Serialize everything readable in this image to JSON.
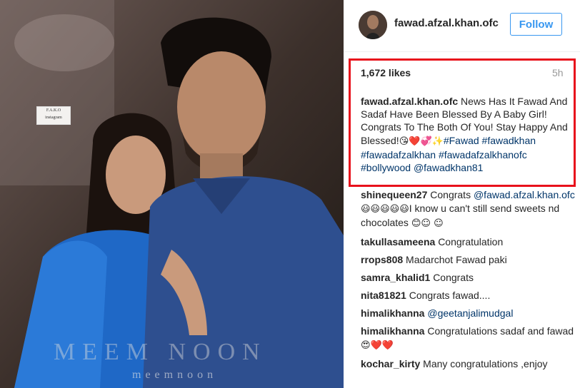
{
  "header": {
    "username": "fawad.afzal.khan.ofc",
    "follow_label": "Follow"
  },
  "post": {
    "likes": "1,672 likes",
    "time": "5h",
    "caption_user": "fawad.afzal.khan.ofc",
    "caption_text": "News Has It Fawad And Sadaf Have Been Blessed By A Baby Girl! Congrats To The Both Of You! Stay Happy And Blessed!",
    "caption_emoji": "😘❤️💞✨",
    "hashtags": [
      "#Fawad",
      "#fawadkhan",
      "#fawadafzalkhan",
      "#fawadafzalkhanofc",
      "#bollywood"
    ],
    "mention": "@fawadkhan81"
  },
  "photo": {
    "logo_text_1": "F.A.K.O",
    "logo_text_2": "instagram",
    "watermark_main": "MEEM NOON",
    "watermark_sub": "meemnoon"
  },
  "comments": [
    {
      "user": "shinequeen27",
      "text": "Congrats",
      "mention": "@fawad.afzal.khan.ofc",
      "emoji": "😃😃😃😃😃",
      "text2": "I know u can't still send sweets nd chocolates",
      "emoji2": "😊☺ ☺"
    },
    {
      "user": "takullasameena",
      "text": "Congratulation"
    },
    {
      "user": "rrops808",
      "text": "Madarchot Fawad paki"
    },
    {
      "user": "samra_khalid1",
      "text": "Congrats"
    },
    {
      "user": "nita81821",
      "text": "Congrats fawad...."
    },
    {
      "user": "himalikhanna",
      "mention": "@geetanjalimudgal"
    },
    {
      "user": "himalikhanna",
      "text": "Congratulations sadaf and fawad",
      "emoji": "😍❤️❤️"
    },
    {
      "user": "kochar_kirty",
      "text": "Many congratulations ,enjoy"
    }
  ],
  "colors": {
    "accent": "#3897f0",
    "highlight": "#e8111b",
    "link": "#003569"
  }
}
